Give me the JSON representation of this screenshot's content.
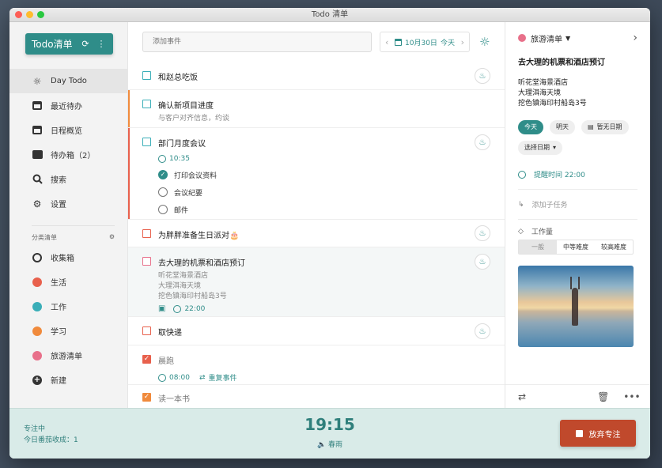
{
  "window": {
    "title": "Todo 清单"
  },
  "sidebar": {
    "brand": "Todo清单",
    "nav": [
      {
        "label": "Day Todo",
        "icon": "sun-icon"
      },
      {
        "label": "最近待办",
        "icon": "calendar-icon"
      },
      {
        "label": "日程概览",
        "icon": "schedule-icon"
      },
      {
        "label": "待办箱（2）",
        "icon": "inbox-icon"
      },
      {
        "label": "搜索",
        "icon": "search-icon"
      },
      {
        "label": "设置",
        "icon": "gear-icon"
      }
    ],
    "section_label": "分类清单",
    "lists": [
      {
        "label": "收集箱",
        "color": ""
      },
      {
        "label": "生活",
        "color": "#e8604c"
      },
      {
        "label": "工作",
        "color": "#3aaeb8"
      },
      {
        "label": "学习",
        "color": "#f08a3c"
      },
      {
        "label": "旅游清单",
        "color": "#e8708a"
      },
      {
        "label": "新建",
        "color": ""
      }
    ]
  },
  "toolbar": {
    "add_placeholder": "添加事件",
    "date": "10月30日",
    "today": "今天"
  },
  "tasks": {
    "t1": {
      "title": "和赵总吃饭"
    },
    "t2": {
      "title": "确认新项目进度",
      "note": "与客户对齐信息，约谈"
    },
    "t3": {
      "title": "部门月度会议",
      "time": "10:35",
      "subtasks": [
        "打印会议资料",
        "会议纪要",
        "邮件"
      ]
    },
    "t4": {
      "title": "为胖胖准备生日派对🎂"
    },
    "t5": {
      "title": "去大理的机票和酒店预订",
      "notes": [
        "听花堂海景酒店",
        "大理洱海天境",
        "挖色镇海印村船岛3号"
      ],
      "time": "22:00"
    },
    "t6": {
      "title": "取快递"
    },
    "t7": {
      "title": "晨跑",
      "time": "08:00",
      "repeat": "重复事件"
    },
    "t8": {
      "title": "读一本书"
    }
  },
  "detail": {
    "list_name": "旅游清单",
    "title": "去大理的机票和酒店预订",
    "notes": [
      "听花堂海景酒店",
      "大理洱海天境",
      "挖色镇海印村船岛3号"
    ],
    "chips": {
      "today": "今天",
      "tomorrow": "明天",
      "no_date": "暂无日期",
      "pick": "选择日期"
    },
    "reminder": "提醒时间 22:00",
    "add_subtask": "添加子任务",
    "workload_label": "工作量",
    "workload": [
      "一般",
      "中等难度",
      "较高难度"
    ]
  },
  "focus": {
    "status": "专注中",
    "count": "今日番茄收成：1",
    "time": "19:15",
    "sound": "春雨",
    "give_up": "放弃专注"
  }
}
